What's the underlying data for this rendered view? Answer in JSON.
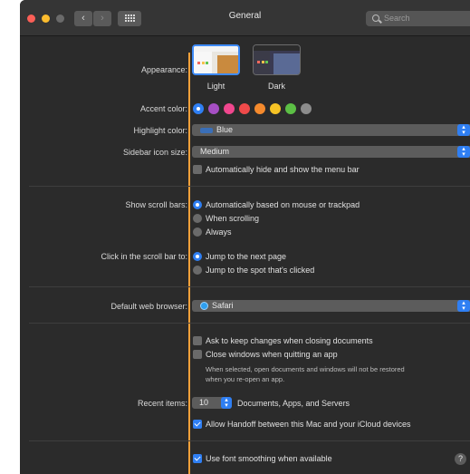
{
  "window": {
    "title": "General",
    "search_placeholder": "Search"
  },
  "appearance": {
    "label": "Appearance:",
    "options": [
      {
        "label": "Light",
        "selected": true
      },
      {
        "label": "Dark",
        "selected": false
      }
    ]
  },
  "accent": {
    "label": "Accent color:",
    "colors": [
      "#2f7ff3",
      "#a64fc4",
      "#f0478e",
      "#ef4a4a",
      "#f58a2d",
      "#f6c325",
      "#5cbf45",
      "#8c8c8c"
    ],
    "selected_index": 0
  },
  "highlight": {
    "label": "Highlight color:",
    "value": "Blue"
  },
  "sidebar_icon": {
    "label": "Sidebar icon size:",
    "value": "Medium"
  },
  "menubar": {
    "label": "Automatically hide and show the menu bar",
    "checked": false
  },
  "scrollbars": {
    "label": "Show scroll bars:",
    "options": [
      {
        "label": "Automatically based on mouse or trackpad",
        "selected": true
      },
      {
        "label": "When scrolling",
        "selected": false
      },
      {
        "label": "Always",
        "selected": false
      }
    ]
  },
  "scroll_click": {
    "label": "Click in the scroll bar to:",
    "options": [
      {
        "label": "Jump to the next page",
        "selected": true
      },
      {
        "label": "Jump to the spot that's clicked",
        "selected": false
      }
    ]
  },
  "browser": {
    "label": "Default web browser:",
    "value": "Safari"
  },
  "documents": {
    "ask_label": "Ask to keep changes when closing documents",
    "ask_checked": false,
    "close_label": "Close windows when quitting an app",
    "close_checked": false,
    "note_line1": "When selected, open documents and windows will not be restored",
    "note_line2": "when you re-open an app."
  },
  "recent": {
    "label": "Recent items:",
    "value": "10",
    "suffix": "Documents, Apps, and Servers"
  },
  "handoff": {
    "label": "Allow Handoff between this Mac and your iCloud devices",
    "checked": true
  },
  "smoothing": {
    "label": "Use font smoothing when available",
    "checked": true
  },
  "help_label": "?"
}
